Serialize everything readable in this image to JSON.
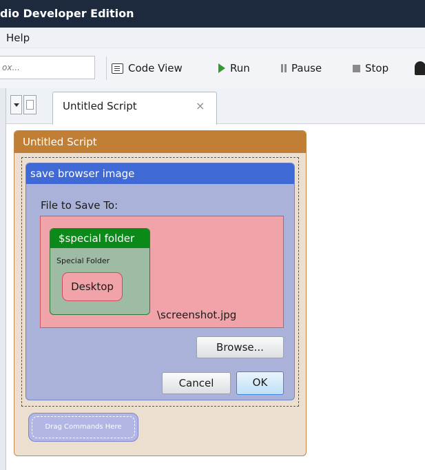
{
  "window": {
    "title": "dio Developer Edition"
  },
  "menu": {
    "items": [
      "Help"
    ]
  },
  "toolbar": {
    "search_placeholder": "ox...",
    "code_view_label": "Code View",
    "run_label": "Run",
    "pause_label": "Pause",
    "stop_label": "Stop",
    "icons": {
      "code_view": "code-view-icon",
      "run": "play-icon",
      "pause": "pause-icon",
      "stop": "stop-icon",
      "extra": "bell-icon"
    },
    "run_color": "#2f9a2f"
  },
  "tabs": [
    {
      "label": "Untitled Script",
      "close": "×",
      "active": true
    }
  ],
  "script": {
    "title": "Untitled Script",
    "header_color": "#c07f34",
    "drag_placeholder": "Drag Commands Here",
    "command": {
      "title": "save browser image",
      "header_color": "#3f6ad6",
      "field_label": "File to Save To:",
      "special_folder": {
        "title": "$special folder",
        "header_color": "#0b8a1a",
        "label": "Special Folder",
        "value": "Desktop"
      },
      "filename": "\\screenshot.jpg",
      "browse_label": "Browse...",
      "cancel_label": "Cancel",
      "ok_label": "OK"
    }
  }
}
